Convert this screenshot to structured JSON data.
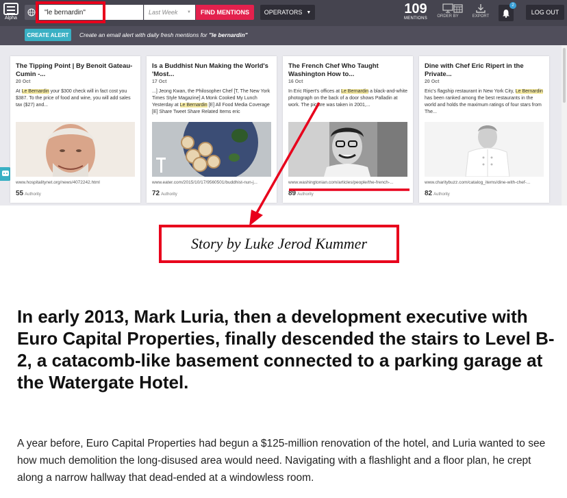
{
  "header": {
    "logo_text": "Alpha",
    "search_value": "\"le bernardin\"",
    "date_filter": "Last Week",
    "find_label": "FIND MENTIONS",
    "operators_label": "OPERATORS",
    "mentions_count": "109",
    "mentions_label": "MENTIONS",
    "order_by_label": "ORDER BY",
    "export_label": "EXPORT",
    "notification_count": "2",
    "logout_label": "LOG OUT"
  },
  "alert_bar": {
    "button_label": "CREATE ALERT",
    "description_prefix": "Create an email alert with daily fresh mentions for",
    "description_query": "\"le bernardin\""
  },
  "cards": [
    {
      "title": "The Tipping Point | By Benoit Gateau-Cumin -...",
      "date": "20 Oct",
      "snippet_pre": "At ",
      "snippet_hl": "Le Bernardin",
      "snippet_post": " your $300 check will in fact cost you $387. To the price of food and wine, you will add sales tax ($27) and...",
      "url": "www.hospitalitynet.org/news/4072242.html",
      "authority": "55",
      "authority_label": "Authority"
    },
    {
      "title": "Is a Buddhist Nun Making the World's 'Most...",
      "date": "17 Oct",
      "snippet_pre": "...] Jeong Kwan, the Philosopher Chef [T, The New York Times Style Magazine] A Monk Cooked My Lunch Yesterday at ",
      "snippet_hl": "Le Bernardin",
      "snippet_post": " [E] All Food Media Coverage [E] Share Tweet Share Related Items eric",
      "url": "www.eater.com/2015/10/17/9560501/buddhist-nun-j...",
      "authority": "72",
      "authority_label": "Authority"
    },
    {
      "title": "The French Chef Who Taught Washington How to...",
      "date": "16 Oct",
      "snippet_pre": "In Eric Ripert's offices at ",
      "snippet_hl": "Le Bernardin",
      "snippet_post": " a black-and-white photograph on the back of a door shows Palladin at work. The picture was taken in 2001,...",
      "url": "www.washingtonian.com/articles/people/the-french-...",
      "authority": "89",
      "authority_label": "Authority"
    },
    {
      "title": "Dine with Chef Eric Ripert in the Private...",
      "date": "20 Oct",
      "snippet_pre": "Eric's flagship restaurant in New York City, ",
      "snippet_hl": "Le Bernardin",
      "snippet_post": " has been ranked among the best restaurants in the world and holds the maximum ratings of four stars from The...",
      "url": "www.charitybuzz.com/catalog_items/dine-with-chef-...",
      "authority": "82",
      "authority_label": "Authority"
    }
  ],
  "article": {
    "byline": "Story by Luke Jerod Kummer",
    "headline": "In early 2013, Mark Luria, then a development executive with Euro Capital Properties, finally descended the stairs to Level B-2, a catacomb-like basement connected to a parking garage at the Watergate Hotel.",
    "body": "A year before, Euro Capital Properties had begun a $125-million renovation of the hotel, and Luria wanted to see how much demolition the long-disused area would need. Navigating with a flashlight and a floor plan, he crept along a narrow hallway that dead-ended at a windowless room."
  },
  "colors": {
    "topbar": "#45444f",
    "find_button": "#e3214d",
    "create_alert": "#3ab0c4",
    "annotation_red": "#e8001c",
    "highlight": "#f5eaa0"
  }
}
